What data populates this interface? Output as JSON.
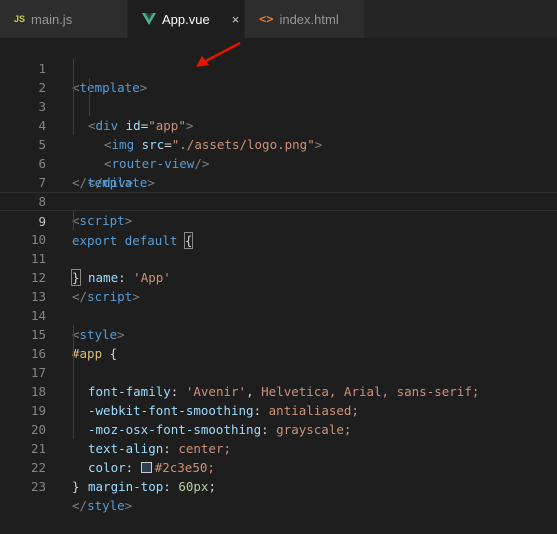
{
  "tabs": [
    {
      "icon": "js-icon",
      "icon_text": "JS",
      "label": "main.js",
      "active": false
    },
    {
      "icon": "vue-icon",
      "label": "App.vue",
      "active": true,
      "close": "×"
    },
    {
      "icon": "html-icon",
      "icon_text": "<>",
      "label": "index.html",
      "active": false
    }
  ],
  "editor": {
    "current_line": 9,
    "lines": [
      {
        "n": "1"
      },
      {
        "n": "2"
      },
      {
        "n": "3"
      },
      {
        "n": "4"
      },
      {
        "n": "5"
      },
      {
        "n": "6"
      },
      {
        "n": "7"
      },
      {
        "n": "8"
      },
      {
        "n": "9"
      },
      {
        "n": "10"
      },
      {
        "n": "11"
      },
      {
        "n": "12"
      },
      {
        "n": "13"
      },
      {
        "n": "14"
      },
      {
        "n": "15"
      },
      {
        "n": "16"
      },
      {
        "n": "17"
      },
      {
        "n": "18"
      },
      {
        "n": "19"
      },
      {
        "n": "20"
      },
      {
        "n": "21"
      },
      {
        "n": "22"
      },
      {
        "n": "23"
      }
    ],
    "code": {
      "l1_tag": "template",
      "l2_tag": "div",
      "l2_attr": "id",
      "l2_val": "\"app\"",
      "l3_tag": "img",
      "l3_attr": "src",
      "l3_val": "\"./assets/logo.png\"",
      "l4_tag": "router-view",
      "l5_tag": "div",
      "l6_tag": "template",
      "l8_tag": "script",
      "l9_kw1": "export",
      "l9_kw2": "default",
      "l9_brace": "{",
      "l10_prop": "name",
      "l10_val": "'App'",
      "l11_brace": "}",
      "l12_tag": "script",
      "l14_tag": "style",
      "l15_sel": "#app",
      "l15_brace": "{",
      "l16_prop": "font-family",
      "l16_v1": "'Avenir'",
      "l16_v2": "Helvetica, Arial, sans-serif;",
      "l17_prop": "-webkit-font-smoothing",
      "l17_val": "antialiased;",
      "l18_prop": "-moz-osx-font-smoothing",
      "l18_val": "grayscale;",
      "l19_prop": "text-align",
      "l19_val": "center;",
      "l20_prop": "color",
      "l20_val": "#2c3e50;",
      "l21_prop": "margin-top",
      "l21_val": "60px",
      "l21_semi": ";",
      "l22_brace": "}",
      "l23_tag": "style"
    }
  },
  "colors": {
    "background": "#1e1e1e",
    "tab_bar": "#252526",
    "tag": "#569cd6",
    "string": "#ce9178",
    "attribute": "#9cdcfe",
    "number": "#b5cea8",
    "selector": "#d7ba7d",
    "arrow_annotation": "#e51400",
    "swatch": "#2c3e50"
  }
}
